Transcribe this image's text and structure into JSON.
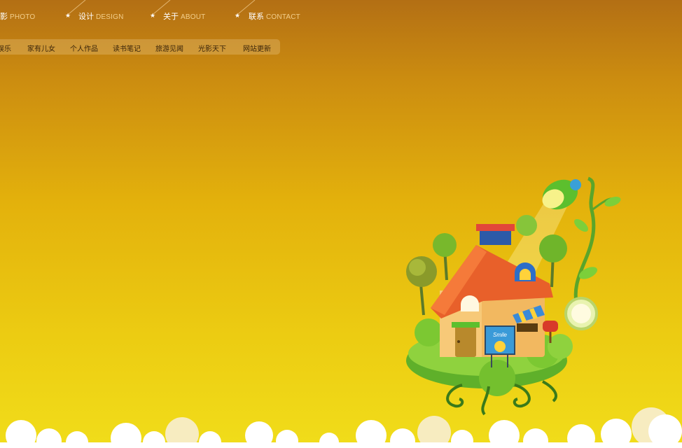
{
  "topnav": {
    "items": [
      {
        "cn": "摄影",
        "en": "PHOTO"
      },
      {
        "cn": "设计",
        "en": "DESIGN"
      },
      {
        "cn": "关于",
        "en": "ABOUT"
      },
      {
        "cn": "联系",
        "en": "CONTACT"
      }
    ]
  },
  "subnav": {
    "items": [
      "娱乐",
      "家有儿女",
      "个人作品",
      "读书笔记",
      "旅游见闻",
      "光影天下",
      "网站更新"
    ]
  },
  "illustration": {
    "sign_text": "Smile"
  },
  "colors": {
    "bg_top": "#b36f14",
    "bg_bottom": "#f1dd1a",
    "roof": "#e8602a",
    "grass": "#7cc832"
  }
}
